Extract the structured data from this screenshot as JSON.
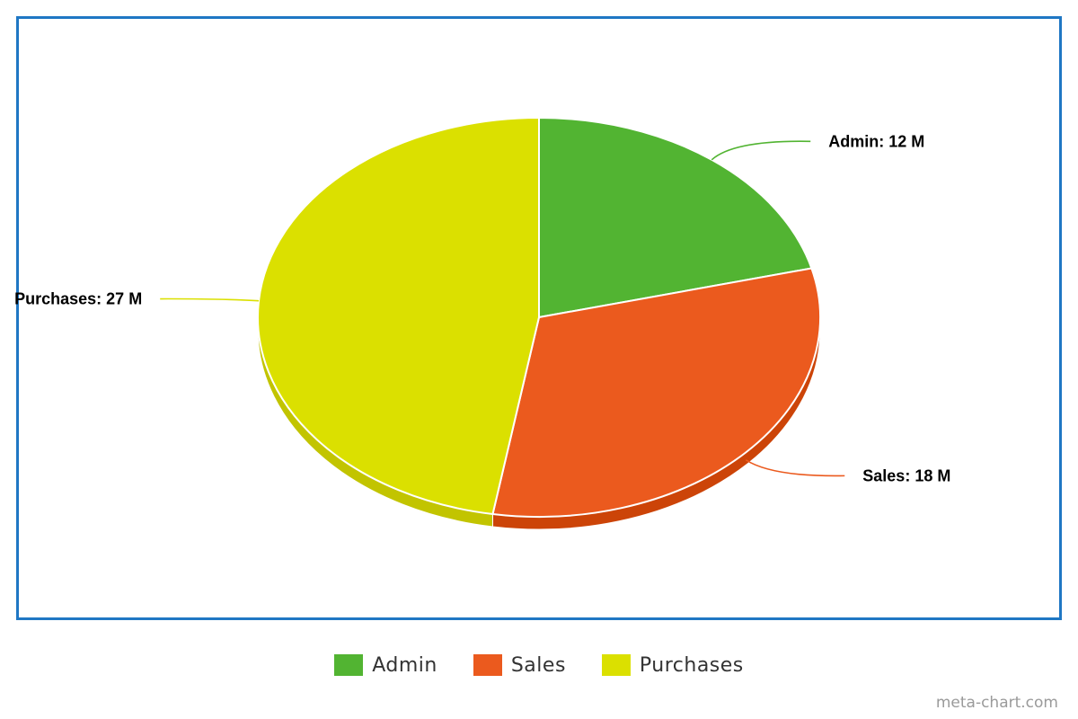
{
  "chart_data": {
    "type": "pie",
    "title": "",
    "unit_suffix": "M",
    "slices": [
      {
        "name": "Admin",
        "value": 12,
        "label": "Admin: 12 M",
        "color": "#52b432",
        "side_color": "#3f8f25"
      },
      {
        "name": "Sales",
        "value": 18,
        "label": "Sales: 18 M",
        "color": "#eb5a1e",
        "side_color": "#cc4408"
      },
      {
        "name": "Purchases",
        "value": 27,
        "label": "Purchases: 27 M",
        "color": "#dbe000",
        "side_color": "#c2c400"
      }
    ],
    "legend_position": "bottom",
    "legend": [
      {
        "label": "Admin",
        "color": "#52b432"
      },
      {
        "label": "Sales",
        "color": "#eb5a1e"
      },
      {
        "label": "Purchases",
        "color": "#dbe000"
      }
    ]
  },
  "watermark": "meta-chart.com",
  "frame_color": "#1f77c4"
}
